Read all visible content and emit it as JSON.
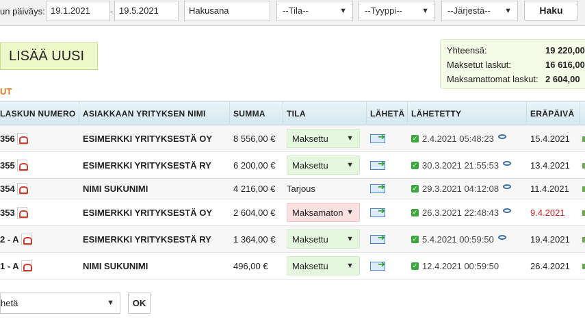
{
  "filters": {
    "date_label": "un päiväys:",
    "date_from": "19.1.2021",
    "date_to": "19.5.2021",
    "dash": "-",
    "search_value": "Hakusana",
    "status_select": "--Tila--",
    "type_select": "--Tyyppi--",
    "sort_select": "--Järjestä--",
    "search_button": "Haku"
  },
  "add_button": "LISÄÄ UUSI",
  "section_label": "UT",
  "summary": {
    "total_label": "Yhteensä:",
    "total_value": "19 220,00",
    "paid_label": "Maksetut laskut:",
    "paid_value": "16 616,00",
    "unpaid_label": "Maksamattomat laskut:",
    "unpaid_value": "2 604,00"
  },
  "table": {
    "headers": {
      "number": "LASKUN NUMERO",
      "company": "ASIAKKAAN YRITYKSEN NIMI",
      "sum": "SUMMA",
      "status": "TILA",
      "send": "LÄHETÄ",
      "sent": "LÄHETETTY",
      "due": "ERÄPÄIVÄ"
    },
    "rows": [
      {
        "number": "356",
        "company": "ESIMERKKI YRITYKSESTÄ OY",
        "sum": "8 556,00 €",
        "status": "Maksettu",
        "sent": "2.4.2021 05:48:23",
        "due": "15.4.2021"
      },
      {
        "number": "355",
        "company": "ESIMERKKI YRITYKSESTÄ RY",
        "sum": "6 200,00 €",
        "status": "Maksettu",
        "sent": "30.3.2021 21:55:53",
        "due": "13.4.2021"
      },
      {
        "number": "354",
        "company": "NIMI SUKUNIMI",
        "sum": "4 216,00 €",
        "status": "Tarjous",
        "sent": "29.3.2021 04:12:08",
        "due": "11.4.2021"
      },
      {
        "number": "353",
        "company": "ESIMERKKI YRITYKSESTÄ OY",
        "sum": "2 604,00 €",
        "status": "Maksamaton",
        "sent": "26.3.2021 22:48:43",
        "due": "9.4.2021"
      },
      {
        "number": "2 - A",
        "company": "ESIMERKKI YRITYKSESTÄ RY",
        "sum": "1 364,00 €",
        "status": "Maksettu",
        "sent": "5.4.2021 00:59:50",
        "due": "19.4.2021"
      },
      {
        "number": "1 - A",
        "company": "NIMI SUKUNIMI",
        "sum": "496,00 €",
        "status": "Maksettu",
        "sent": "12.4.2021 00:59:50",
        "due": "26.4.2021"
      }
    ]
  },
  "bulk_action": {
    "select_value": "hetä",
    "ok_button": "OK"
  },
  "colors": {
    "paid_bg": "#e6f7e0",
    "unpaid_bg": "#fbe0e0",
    "overdue_text": "#d32020",
    "section_label": "#e07a1f"
  }
}
